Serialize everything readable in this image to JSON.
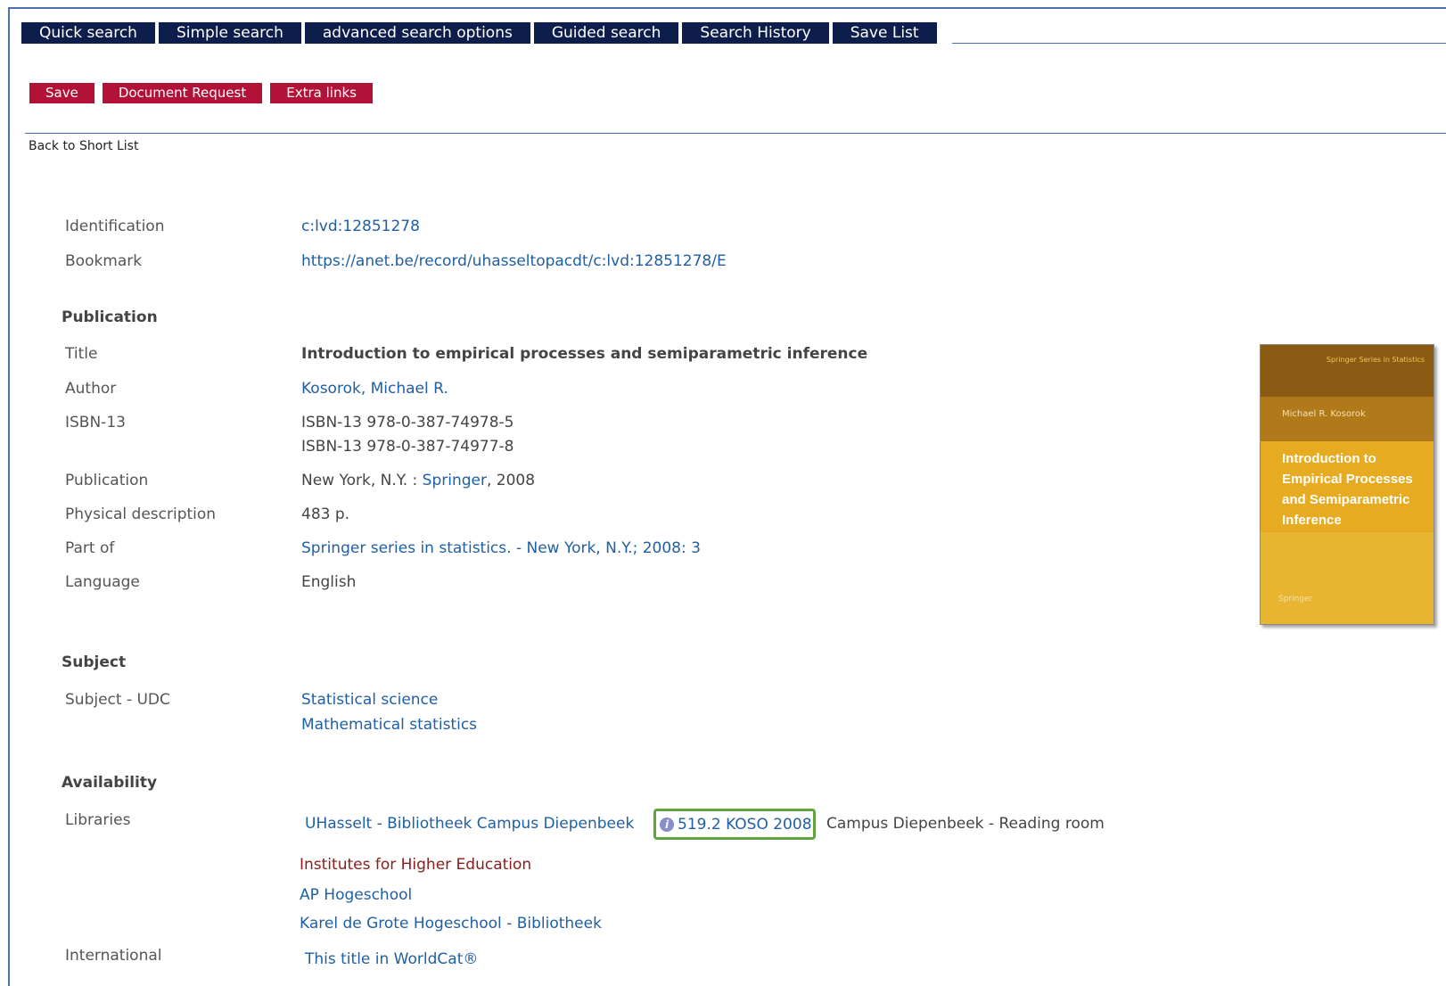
{
  "nav": {
    "tabs": [
      "Quick search",
      "Simple search",
      "advanced search options",
      "Guided search",
      "Search History",
      "Save List"
    ]
  },
  "actions": [
    "Save",
    "Document Request",
    "Extra links"
  ],
  "back_link": "Back to Short List",
  "record": {
    "identification_label": "Identification",
    "identification_value": "c:lvd:12851278",
    "bookmark_label": "Bookmark",
    "bookmark_value": "https://anet.be/record/uhasseltopacdt/c:lvd:12851278/E",
    "publication_section": "Publication",
    "title_label": "Title",
    "title_value": "Introduction to empirical processes and semiparametric inference",
    "author_label": "Author",
    "author_value": "Kosorok, Michael R.",
    "isbn_label": "ISBN-13",
    "isbn_values": [
      "ISBN-13 978-0-387-74978-5",
      "ISBN-13 978-0-387-74977-8"
    ],
    "publication_label": "Publication",
    "publication_place": "New York, N.Y. :",
    "publication_publisher": "Springer",
    "publication_year": ", 2008",
    "physical_label": "Physical description",
    "physical_value": "483 p.",
    "partof_label": "Part of",
    "partof_value": "Springer series in statistics. - New York, N.Y.; 2008: 3",
    "language_label": "Language",
    "language_value": "English",
    "subject_section": "Subject",
    "subject_udc_label": "Subject - UDC",
    "subject_values": [
      "Statistical science",
      "Mathematical statistics"
    ],
    "availability_section": "Availability",
    "libraries_label": "Libraries",
    "library_name": "UHasselt - Bibliotheek Campus Diepenbeek",
    "call_number": "519.2 KOSO 2008",
    "location": "Campus Diepenbeek - Reading room",
    "institutes_heading": "Institutes for Higher Education",
    "institutes": [
      "AP Hogeschool",
      "Karel de Grote Hogeschool - Bibliotheek"
    ],
    "international_label": "International",
    "worldcat_link": "This title in WorldCat®"
  },
  "cover": {
    "series": "Springer Series in Statistics",
    "author": "Michael R. Kosorok",
    "title": "Introduction to Empirical Processes and Semiparametric Inference",
    "publisher": "Springer"
  },
  "colors": {
    "nav_bg": "#0e1e4c",
    "action_bg": "#b21237",
    "link": "#1f5fa3",
    "frame": "#4a6fb5",
    "call_number_border": "#5fa53c"
  },
  "icons": {
    "call_number_icon": "info-icon"
  }
}
